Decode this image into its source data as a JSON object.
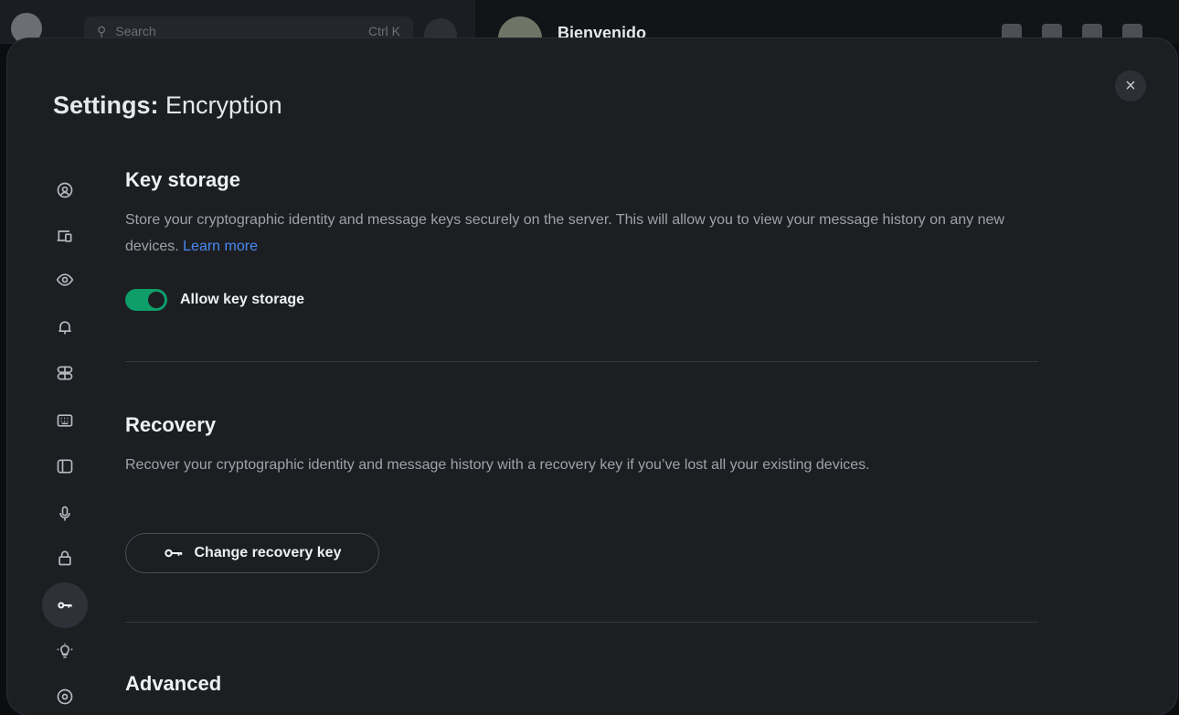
{
  "background": {
    "search_placeholder": "Search",
    "search_shortcut": "Ctrl K",
    "room_name": "Bienvenido"
  },
  "settings": {
    "title_prefix": "Settings:",
    "title_section": "Encryption",
    "close_label": "×",
    "sidebar": [
      {
        "icon": "account-icon"
      },
      {
        "icon": "sessions-icon"
      },
      {
        "icon": "appearance-eye-icon"
      },
      {
        "icon": "notifications-bell-icon"
      },
      {
        "icon": "preferences-icon"
      },
      {
        "icon": "keyboard-icon"
      },
      {
        "icon": "sidebar-icon"
      },
      {
        "icon": "voice-video-mic-icon"
      },
      {
        "icon": "security-lock-icon"
      },
      {
        "icon": "encryption-key-icon",
        "active": true
      },
      {
        "icon": "labs-lightbulb-icon"
      },
      {
        "icon": "help-icon"
      }
    ],
    "key_storage": {
      "heading": "Key storage",
      "description": "Store your cryptographic identity and message keys securely on the server. This will allow you to view your message history on any new devices.",
      "link": "Learn more",
      "toggle_label": "Allow key storage",
      "toggle_on": true
    },
    "recovery": {
      "heading": "Recovery",
      "description": "Recover your cryptographic identity and message history with a recovery key if you’ve lost all your existing devices.",
      "button_label": "Change recovery key"
    },
    "advanced": {
      "heading": "Advanced"
    }
  }
}
